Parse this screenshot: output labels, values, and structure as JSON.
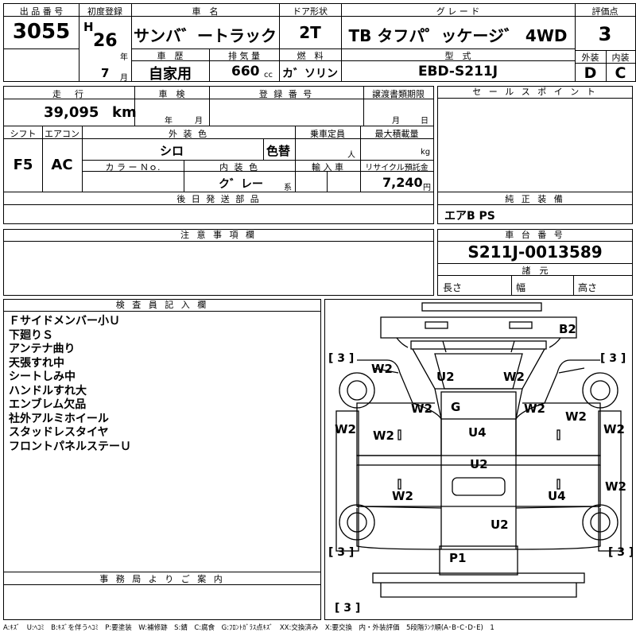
{
  "header": {
    "lot_label": "出 品 番 号",
    "lot_number": "3055",
    "first_reg_label": "初度登録",
    "era": "H",
    "year": "26",
    "year_unit": "年",
    "month": "7",
    "month_unit": "月",
    "car_name_label": "車　名",
    "car_name": "サンバ゛ートラック",
    "door_label": "ドア形状",
    "door": "2T",
    "grade_label": "グ レ ー ド",
    "grade": "TB タフパ゜ッケージ゛ 4WD",
    "score_label": "評価点",
    "score": "3",
    "history_label": "車　歴",
    "history": "自家用",
    "displacement_label": "排 気 量",
    "displacement": "660",
    "displacement_unit": "cc",
    "fuel_label": "燃　料",
    "fuel": "カ゛ソリン",
    "model_label": "型　式",
    "model": "EBD-S211J",
    "exterior_label": "外装",
    "exterior": "D",
    "interior_label": "内装",
    "interior": "C"
  },
  "details": {
    "mileage_label": "走　行",
    "mileage": "39,095",
    "mileage_unit": "km",
    "inspection_label": "車　検",
    "inspection_year_unit": "年",
    "inspection_month_unit": "月",
    "plate_label": "登 録 番 号",
    "transfer_label": "譲渡書類期限",
    "transfer_month_unit": "月",
    "transfer_day_unit": "日",
    "shift_label": "シフト",
    "shift": "F5",
    "ac_label": "エアコン",
    "ac": "AC",
    "color_label": "外 装 色",
    "color": "シロ",
    "color_change": "色替",
    "capacity_label": "乗車定員",
    "capacity_unit": "人",
    "load_label": "最大積載量",
    "load_unit": "kg",
    "color_no_label": "カ ラ ー Ｎｏ.",
    "int_color_label": "内 装 色",
    "int_color": "ク゛レー",
    "int_color_unit": "系",
    "import_label": "輸 入 車",
    "recycle_label": "リサイクル預託金",
    "recycle": "7,240",
    "recycle_unit": "円",
    "later_parts_label": "後 日 発 送 部 品",
    "sales_points_label": "セ ー ル ス ポ イ ン ト",
    "genuine_label": "純 正 装 備",
    "genuine": "エアB PS"
  },
  "notes_box": {
    "caution_label": "注 意 事 項 欄",
    "chassis_label": "車 台 番 号",
    "chassis": "S211J-0013589",
    "spec_label": "諸　元",
    "length_label": "長さ",
    "width_label": "幅",
    "height_label": "高さ",
    "inspector_label": "検 査 員 記 入 欄",
    "inspector_notes": "Ｆサイドメンバー小Ｕ\n下廻りＳ\nアンテナ曲り\n天張すれ中\nシートしみ中\nハンドルすれ大\nエンブレム欠品\n社外アルミホイール\nスタッドレスタイヤ\nフロントパネルステーＵ",
    "office_label": "事 務 局 よ り ご 案 内"
  },
  "diagram": {
    "tire_mark": "[ 3 ]",
    "marks": [
      "B2",
      "W2",
      "U2",
      "W2",
      "W2",
      "G",
      "W2",
      "W2",
      "W2",
      "W2",
      "W2",
      "U4",
      "U2",
      "W2",
      "W2",
      "U4",
      "U2",
      "P1"
    ]
  },
  "legend": "A:ｷｽﾞ　U:ﾍｺﾐ　B:ｷｽﾞを伴うﾍｺﾐ　P:要塗装　W:補修跡　S:錆　C:腐食　G:ﾌﾛﾝﾄｶﾞﾗｽ点ｷｽﾞ　XX:交換済み　X:要交換　内・外装評価　5段階ﾗﾝｸ順(A･B･C･D･E)　1"
}
